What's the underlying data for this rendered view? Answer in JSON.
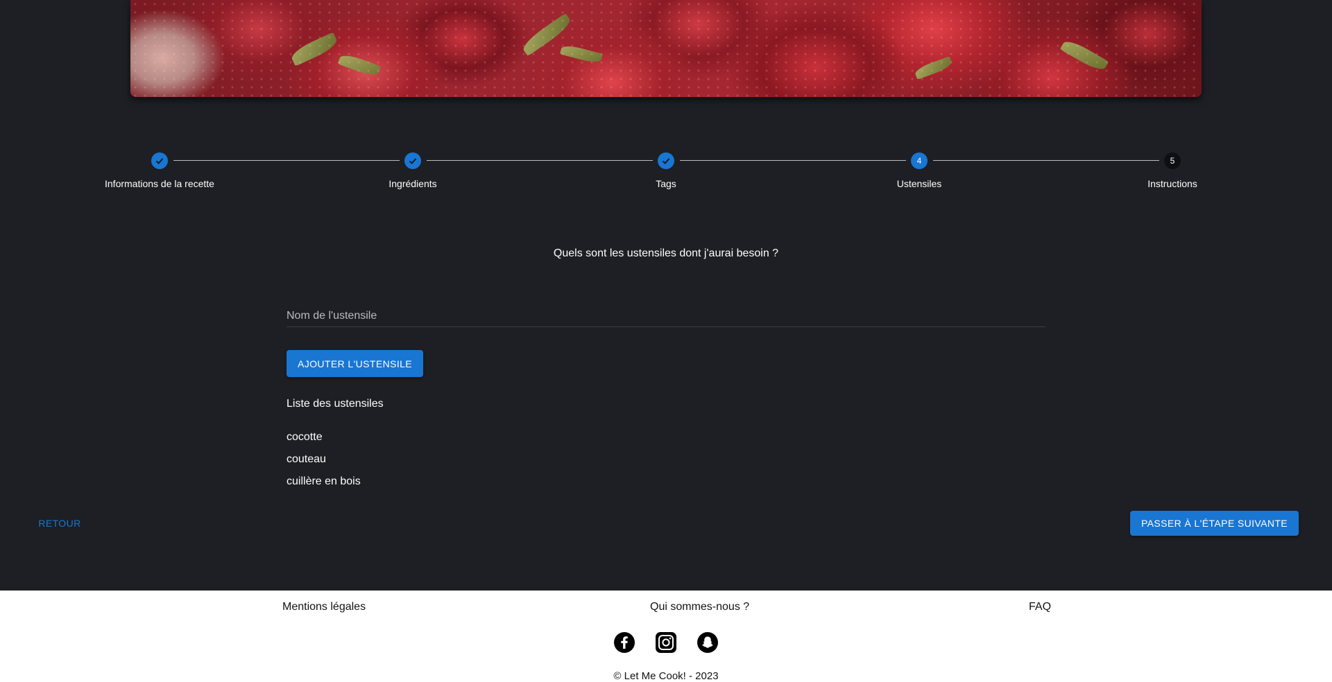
{
  "stepper": {
    "steps": [
      {
        "label": "Informations de la recette",
        "state": "completed",
        "number": "1"
      },
      {
        "label": "Ingrédients",
        "state": "completed",
        "number": "2"
      },
      {
        "label": "Tags",
        "state": "completed",
        "number": "3"
      },
      {
        "label": "Ustensiles",
        "state": "active",
        "number": "4"
      },
      {
        "label": "Instructions",
        "state": "inactive",
        "number": "5"
      }
    ]
  },
  "form": {
    "question": "Quels sont les ustensiles dont j'aurai besoin ?",
    "input_placeholder": "Nom de l'ustensile",
    "input_value": "",
    "add_button": "Ajouter l'ustensile",
    "list_title": "Liste des ustensiles",
    "utensils": [
      "cocotte",
      "couteau",
      "cuillère en bois"
    ]
  },
  "navigation": {
    "back_label": "Retour",
    "next_label": "Passer à l'étape suivante"
  },
  "footer": {
    "links": [
      "Mentions légales",
      "Qui sommes-nous ?",
      "FAQ"
    ],
    "socials": [
      "facebook-icon",
      "instagram-icon",
      "snapchat-icon"
    ],
    "copyright": "© Let Me Cook! - 2023"
  },
  "colors": {
    "background": "#1d1f24",
    "accent": "#1976d2",
    "footer_background": "#ffffff"
  }
}
